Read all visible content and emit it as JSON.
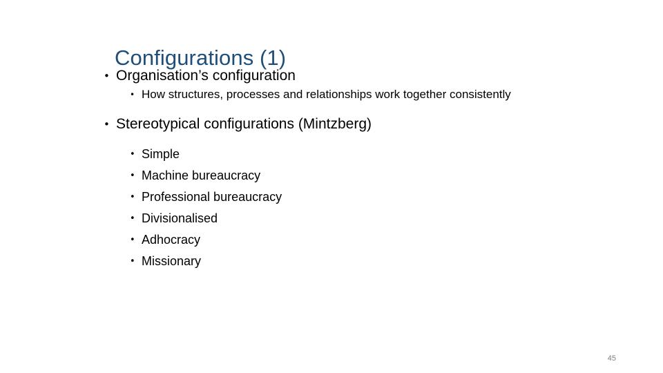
{
  "slide": {
    "title": "Configurations (1)",
    "title_color": "#1F4E79",
    "background_color": "#FFFFFF",
    "body_text_color": "#000000",
    "page_number": "45",
    "page_number_color": "#808080",
    "bullet_glyph": "•"
  },
  "content": {
    "blocks": [
      {
        "level": 1,
        "text": "Organisation’s configuration"
      },
      {
        "level": 2,
        "text": "How structures, processes and relationships work together consistently"
      },
      {
        "level": 1,
        "text": "Stereotypical configurations (Mintzberg)"
      }
    ],
    "mintzberg_configurations": [
      "Simple",
      "Machine bureaucracy",
      "Professional bureaucracy",
      "Divisionalised",
      "Adhocracy",
      "Missionary"
    ]
  }
}
